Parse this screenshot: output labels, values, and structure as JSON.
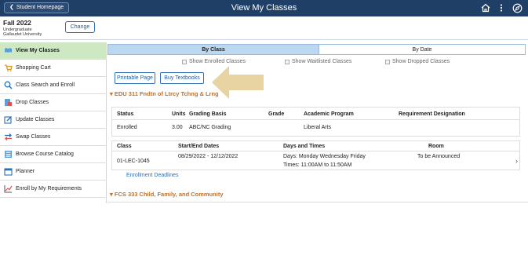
{
  "topbar": {
    "back_label": "Student Homepage",
    "title": "View My Classes",
    "icons": [
      "home-icon",
      "more-vert-icon",
      "compass-icon"
    ]
  },
  "term": {
    "name": "Fall 2022",
    "career": "Undergraduate",
    "institution": "Gallaudet University",
    "change_label": "Change"
  },
  "sidebar": {
    "items": [
      {
        "label": "View My Classes",
        "icon": "book-icon",
        "active": true
      },
      {
        "label": "Shopping Cart",
        "icon": "cart-icon"
      },
      {
        "label": "Class Search and Enroll",
        "icon": "search-icon"
      },
      {
        "label": "Drop Classes",
        "icon": "drop-icon"
      },
      {
        "label": "Update Classes",
        "icon": "edit-icon"
      },
      {
        "label": "Swap Classes",
        "icon": "swap-icon"
      },
      {
        "label": "Browse Course Catalog",
        "icon": "catalog-icon"
      },
      {
        "label": "Planner",
        "icon": "calendar-icon"
      },
      {
        "label": "Enroll by My Requirements",
        "icon": "chart-icon"
      }
    ]
  },
  "tabs": [
    {
      "label": "By Class",
      "active": true
    },
    {
      "label": "By Date",
      "active": false
    }
  ],
  "filters": {
    "show_enrolled": "Show Enrolled Classes",
    "show_waitlisted": "Show Waitlisted Classes",
    "show_dropped": "Show Dropped Classes"
  },
  "actions": {
    "printable": "Printable Page",
    "textbooks": "Buy Textbooks"
  },
  "courses": [
    {
      "title": "EDU 311 Fndtn of Ltrcy Tchng & Lrng",
      "status_headers": [
        "Status",
        "Units",
        "Grading Basis",
        "Grade",
        "Academic Program",
        "Requirement Designation"
      ],
      "status_row": {
        "status": "Enrolled",
        "units": "3.00",
        "grading": "ABC/NC Grading",
        "grade": "",
        "program": "Liberal Arts",
        "requirement": ""
      },
      "class_headers": [
        "Class",
        "Start/End Dates",
        "Days and Times",
        "Room"
      ],
      "class_row": {
        "class": "01-LEC-1045",
        "dates": "08/29/2022 - 12/12/2022",
        "days": "Days: Monday Wednesday Friday",
        "times": "Times: 11:00AM to 11:50AM",
        "room": "To be Announced"
      },
      "deadlines_link": "Enrollment Deadlines"
    },
    {
      "title": "FCS 333 Child, Family, and Community"
    }
  ],
  "colors": {
    "topbar": "#1f3f66",
    "active_tab": "#bcd7f0",
    "active_side": "#cde8c3",
    "course_title": "#c0702a",
    "link": "#2d6fb2",
    "arrow": "#e6cf9a"
  }
}
